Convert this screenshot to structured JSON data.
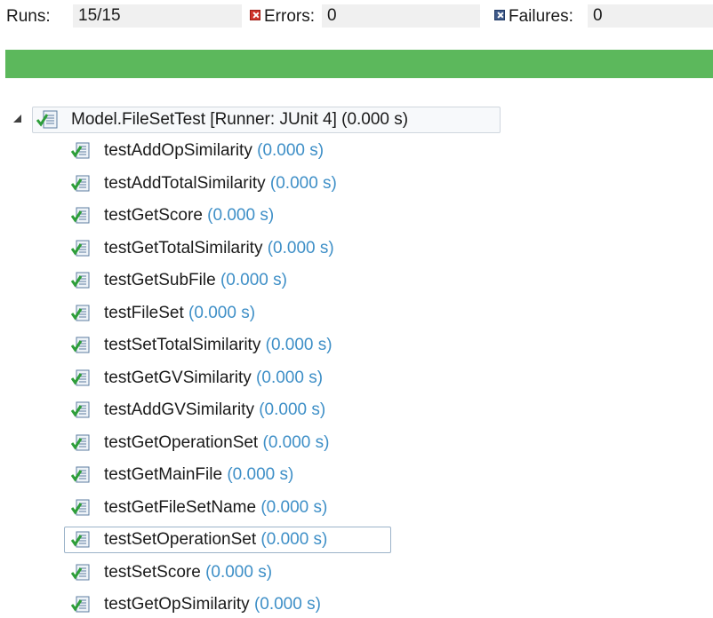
{
  "counters": {
    "runs_label": "Runs:",
    "runs_value": "15/15",
    "errors_label": "Errors:",
    "errors_value": "0",
    "failures_label": "Failures:",
    "failures_value": "0"
  },
  "progress": {
    "fraction": 1.0,
    "color": "#5cb85c"
  },
  "suite": {
    "label": "Model.FileSetTest [Runner: JUnit 4] (0.000 s)",
    "expanded": true
  },
  "tests": [
    {
      "name": "testAddOpSimilarity",
      "time": "(0.000 s)"
    },
    {
      "name": "testAddTotalSimilarity",
      "time": "(0.000 s)"
    },
    {
      "name": "testGetScore",
      "time": "(0.000 s)"
    },
    {
      "name": "testGetTotalSimilarity",
      "time": "(0.000 s)"
    },
    {
      "name": "testGetSubFile",
      "time": "(0.000 s)"
    },
    {
      "name": "testFileSet",
      "time": "(0.000 s)"
    },
    {
      "name": "testSetTotalSimilarity",
      "time": "(0.000 s)"
    },
    {
      "name": "testGetGVSimilarity",
      "time": "(0.000 s)"
    },
    {
      "name": "testAddGVSimilarity",
      "time": "(0.000 s)"
    },
    {
      "name": "testGetOperationSet",
      "time": "(0.000 s)"
    },
    {
      "name": "testGetMainFile",
      "time": "(0.000 s)"
    },
    {
      "name": "testGetFileSetName",
      "time": "(0.000 s)"
    },
    {
      "name": "testSetOperationSet",
      "time": "(0.000 s)",
      "focused": true
    },
    {
      "name": "testSetScore",
      "time": "(0.000 s)"
    },
    {
      "name": "testGetOpSimilarity",
      "time": "(0.000 s)"
    }
  ],
  "icons": {
    "suite": "test-suite-passed-icon",
    "test": "test-passed-icon",
    "errors": "error-icon",
    "failures": "failure-icon",
    "twisty": "expanded-triangle-icon"
  }
}
